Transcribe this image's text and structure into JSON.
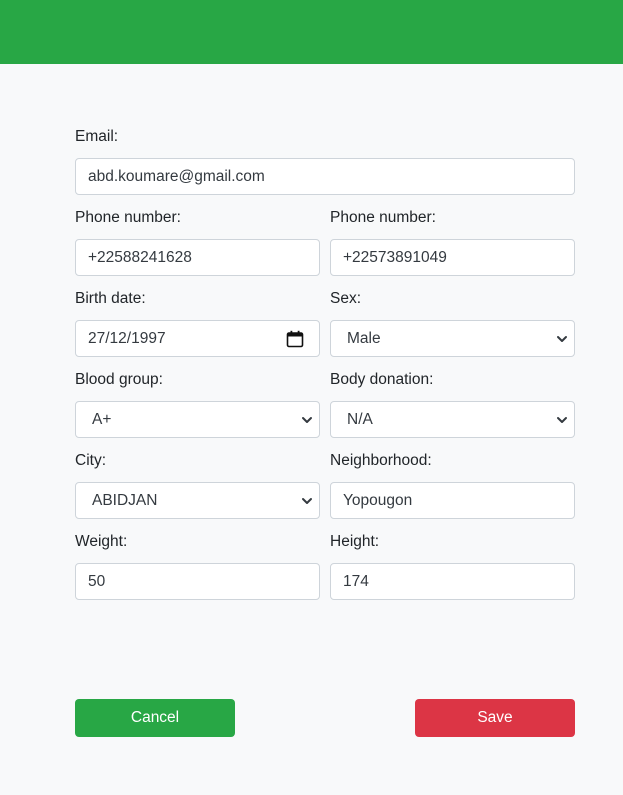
{
  "header": {
    "color": "#28a745"
  },
  "form": {
    "email": {
      "label": "Email:",
      "value": "abd.koumare@gmail.com"
    },
    "phone1": {
      "label": "Phone number:",
      "value": "+22588241628"
    },
    "phone2": {
      "label": "Phone number:",
      "value": "+22573891049"
    },
    "birth_date": {
      "label": "Birth date:",
      "value": "27/12/1997",
      "icon": "calendar-icon"
    },
    "sex": {
      "label": "Sex:",
      "selected": "Male"
    },
    "blood_group": {
      "label": "Blood group:",
      "selected": "A+"
    },
    "body_donation": {
      "label": "Body donation:",
      "selected": "N/A"
    },
    "city": {
      "label": "City:",
      "selected": "ABIDJAN"
    },
    "neighborhood": {
      "label": "Neighborhood:",
      "value": "Yopougon"
    },
    "weight": {
      "label": "Weight:",
      "value": "50"
    },
    "height": {
      "label": "Height:",
      "value": "174"
    }
  },
  "actions": {
    "cancel_label": "Cancel",
    "cancel_color": "#28a745",
    "save_label": "Save",
    "save_color": "#dc3545"
  }
}
